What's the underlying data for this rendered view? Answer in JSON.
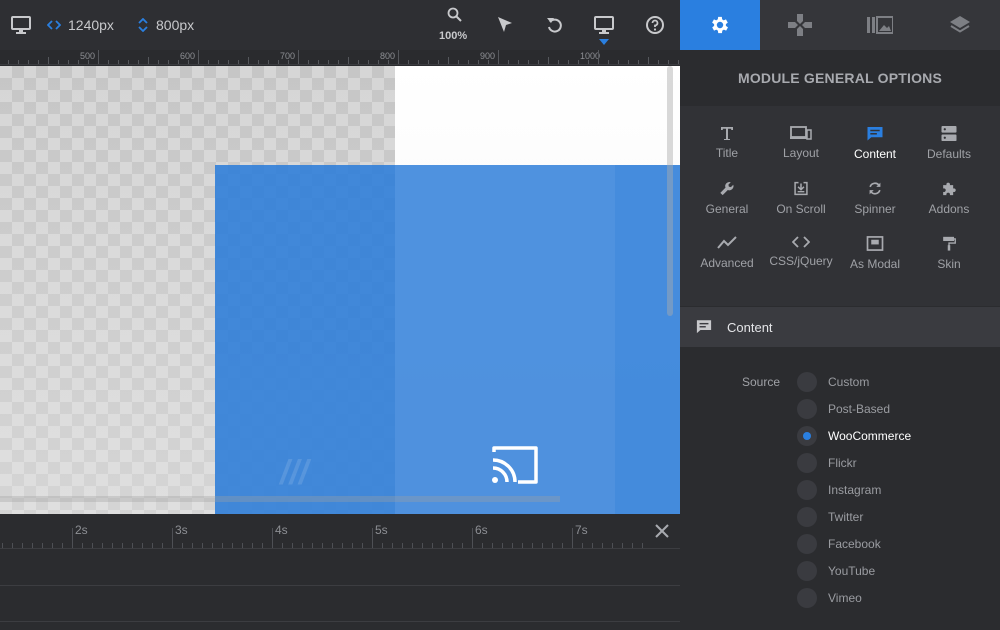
{
  "toolbar": {
    "width_value": "1240px",
    "height_value": "800px",
    "zoom": "100%"
  },
  "ruler": {
    "labels": [
      "500",
      "600",
      "700",
      "800",
      "900",
      "1000"
    ]
  },
  "timeline": {
    "labels": [
      "2s",
      "3s",
      "4s",
      "5s",
      "6s",
      "7s"
    ]
  },
  "panel": {
    "title": "MODULE GENERAL OPTIONS",
    "options": [
      {
        "label": "Title",
        "icon": "title-icon"
      },
      {
        "label": "Layout",
        "icon": "layout-icon"
      },
      {
        "label": "Content",
        "icon": "content-icon",
        "active": true
      },
      {
        "label": "Defaults",
        "icon": "defaults-icon"
      },
      {
        "label": "General",
        "icon": "wrench-icon"
      },
      {
        "label": "On Scroll",
        "icon": "download-box-icon"
      },
      {
        "label": "Spinner",
        "icon": "refresh-icon"
      },
      {
        "label": "Addons",
        "icon": "puzzle-icon"
      },
      {
        "label": "Advanced",
        "icon": "trend-icon"
      },
      {
        "label": "CSS/jQuery",
        "icon": "code-icon"
      },
      {
        "label": "As Modal",
        "icon": "modal-icon"
      },
      {
        "label": "Skin",
        "icon": "paint-roller-icon"
      }
    ],
    "section": {
      "title": "Content",
      "source_label": "Source",
      "sources": [
        "Custom",
        "Post-Based",
        "WooCommerce",
        "Flickr",
        "Instagram",
        "Twitter",
        "Facebook",
        "YouTube",
        "Vimeo"
      ],
      "selected": "WooCommerce"
    }
  },
  "colors": {
    "accent": "#2a7fe0",
    "panel_bg": "#2b2c2f",
    "canvas_blue": "#2b7cd8"
  }
}
